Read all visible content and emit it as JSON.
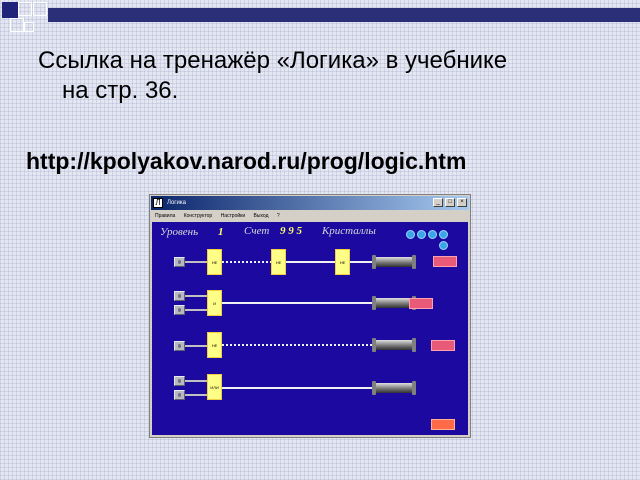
{
  "slide": {
    "bullet_line1": "Ссылка на тренажёр «Логика» в учебнике",
    "bullet_line2": "на стр. 36.",
    "url": "http://kpolyakov.narod.ru/prog/logic.htm"
  },
  "app": {
    "window_title": "Логика",
    "icon_glyph": "Л",
    "menu": [
      "Правила",
      "Конструктор",
      "Настройки",
      "Выход",
      "?"
    ],
    "hud": {
      "level_label": "Уровень",
      "level_value": "1",
      "score_label": "Счет",
      "score_value": "9 9 5",
      "crystals_label": "Кристаллы"
    },
    "gates": [
      "НЕ",
      "НЕ",
      "НЕ",
      "И",
      "НЕ",
      "ИЛИ"
    ],
    "crystal_count": 5
  },
  "colors": {
    "game_bg": "#1c0aa0",
    "lamp": "#e85a78",
    "gate": "#ffff88",
    "crystal": "#3aa6e8",
    "titlebar": "#0a246a"
  }
}
